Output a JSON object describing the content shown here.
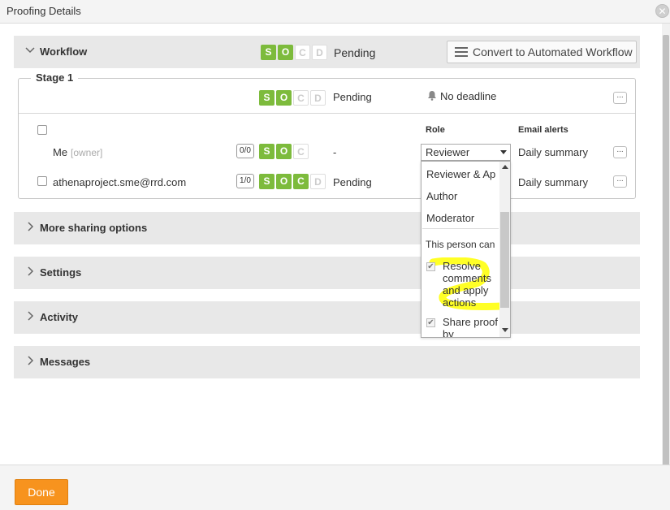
{
  "dialog": {
    "title": "Proofing Details",
    "close_glyph": "✕"
  },
  "workflow": {
    "label": "Workflow",
    "status": "Pending",
    "badges": [
      "S",
      "O",
      "C",
      "D"
    ],
    "convert_button": "Convert to Automated Workflow"
  },
  "stage": {
    "label": "Stage 1",
    "status": "Pending",
    "deadline": "No deadline",
    "badges": [
      "S",
      "O",
      "C",
      "D"
    ],
    "column_role": "Role",
    "column_email": "Email alerts",
    "members": [
      {
        "name": "Me",
        "tag": "[owner]",
        "count": "0/0",
        "badges": [
          "S",
          "O",
          "C"
        ],
        "status": "-",
        "role": "Reviewer",
        "email_alerts": "Daily summary"
      },
      {
        "name": "athenaproject.sme@rrd.com",
        "count": "1/0",
        "badges": [
          "S",
          "O",
          "C",
          "D"
        ],
        "status": "Pending",
        "email_alerts": "Daily summary"
      }
    ]
  },
  "role_dropdown": {
    "options": [
      "Reviewer & Ap",
      "Author",
      "Moderator"
    ],
    "permissions_heading": "This person can",
    "permissions": [
      {
        "label": "Resolve comments and apply actions",
        "checked": true
      },
      {
        "label": "Share proof by",
        "checked": true
      }
    ]
  },
  "sections": [
    "More sharing options",
    "Settings",
    "Activity",
    "Messages"
  ],
  "footer": {
    "done_label": "Done"
  },
  "colors": {
    "badge_green": "#7dbb3c",
    "done_orange": "#f7931e",
    "highlight": "#ffff00"
  }
}
